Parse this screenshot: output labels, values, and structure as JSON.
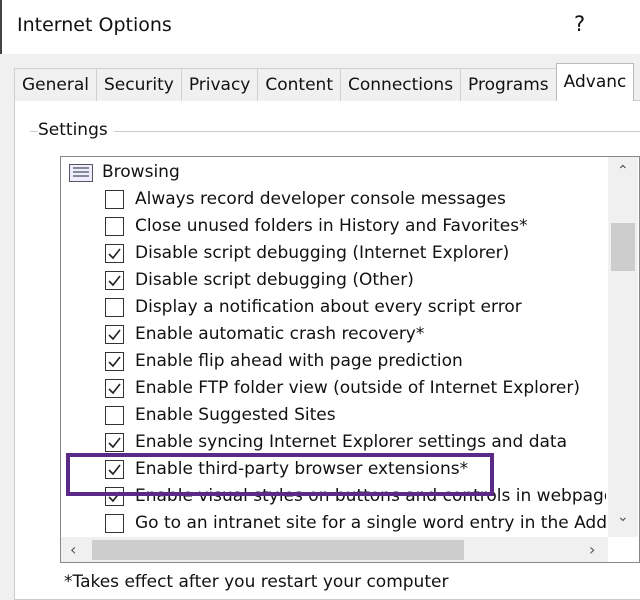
{
  "window": {
    "title": "Internet Options",
    "help": "?"
  },
  "tabs": [
    {
      "label": "General"
    },
    {
      "label": "Security"
    },
    {
      "label": "Privacy"
    },
    {
      "label": "Content"
    },
    {
      "label": "Connections"
    },
    {
      "label": "Programs"
    },
    {
      "label": "Advanc",
      "selected": true
    }
  ],
  "settings": {
    "label": "Settings",
    "group": "Browsing",
    "items": [
      {
        "label": "Always record developer console messages",
        "checked": false
      },
      {
        "label": "Close unused folders in History and Favorites*",
        "checked": false
      },
      {
        "label": "Disable script debugging (Internet Explorer)",
        "checked": true
      },
      {
        "label": "Disable script debugging (Other)",
        "checked": true
      },
      {
        "label": "Display a notification about every script error",
        "checked": false
      },
      {
        "label": "Enable automatic crash recovery*",
        "checked": true
      },
      {
        "label": "Enable flip ahead with page prediction",
        "checked": true
      },
      {
        "label": "Enable FTP folder view (outside of Internet Explorer)",
        "checked": true
      },
      {
        "label": "Enable Suggested Sites",
        "checked": false
      },
      {
        "label": "Enable syncing Internet Explorer settings and data",
        "checked": true
      },
      {
        "label": "Enable third-party browser extensions*",
        "checked": true,
        "highlighted": true
      },
      {
        "label": "Enable visual styles on buttons and controls in webpages",
        "checked": true
      },
      {
        "label": "Go to an intranet site for a single word entry in the Addres",
        "checked": false
      }
    ]
  },
  "highlight_color": "#5b2a86",
  "footnote": "*Takes effect after you restart your computer"
}
